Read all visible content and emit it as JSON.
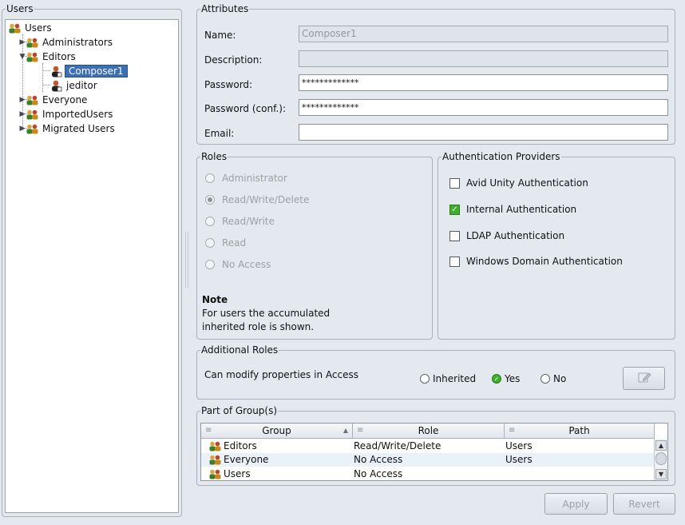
{
  "users_panel": {
    "legend": "Users",
    "tree": {
      "root": "Users",
      "groups": [
        {
          "label": "Administrators",
          "expanded": false
        },
        {
          "label": "Editors",
          "expanded": true,
          "children": [
            "Composer1",
            "jeditor"
          ]
        },
        {
          "label": "Everyone",
          "expanded": false
        },
        {
          "label": "ImportedUsers",
          "expanded": false
        },
        {
          "label": "Migrated Users",
          "expanded": false
        }
      ],
      "selected": "Composer1"
    }
  },
  "attributes": {
    "legend": "Attributes",
    "name_label": "Name:",
    "name_value": "Composer1",
    "description_label": "Description:",
    "description_value": "",
    "password_label": "Password:",
    "password_value": "*************",
    "password_conf_label": "Password (conf.):",
    "password_conf_value": "*************",
    "email_label": "Email:",
    "email_value": ""
  },
  "roles": {
    "legend": "Roles",
    "options": [
      "Administrator",
      "Read/Write/Delete",
      "Read/Write",
      "Read",
      "No Access"
    ],
    "selected": "Read/Write/Delete",
    "note_title": "Note",
    "note_line1": "For users the accumulated",
    "note_line2": "inherited role is shown."
  },
  "auth_providers": {
    "legend": "Authentication Providers",
    "items": [
      {
        "label": "Avid Unity Authentication",
        "checked": false
      },
      {
        "label": "Internal Authentication",
        "checked": true
      },
      {
        "label": "LDAP Authentication",
        "checked": false
      },
      {
        "label": "Windows Domain Authentication",
        "checked": false
      }
    ]
  },
  "additional_roles": {
    "legend": "Additional Roles",
    "question": "Can modify properties in Access",
    "options": [
      "Inherited",
      "Yes",
      "No"
    ],
    "selected": "Yes",
    "edit_icon": "edit-icon"
  },
  "groups": {
    "legend": "Part of Group(s)",
    "columns": [
      "Group",
      "Role",
      "Path"
    ],
    "rows": [
      {
        "group": "Editors",
        "role": "Read/Write/Delete",
        "path": "Users"
      },
      {
        "group": "Everyone",
        "role": "No Access",
        "path": "Users"
      },
      {
        "group": "Users",
        "role": "No Access",
        "path": ""
      }
    ]
  },
  "buttons": {
    "apply": "Apply",
    "revert": "Revert"
  },
  "colors": {
    "background": "#e4e8ef",
    "selection": "#3d6fb6",
    "check_green": "#3fae2b"
  }
}
